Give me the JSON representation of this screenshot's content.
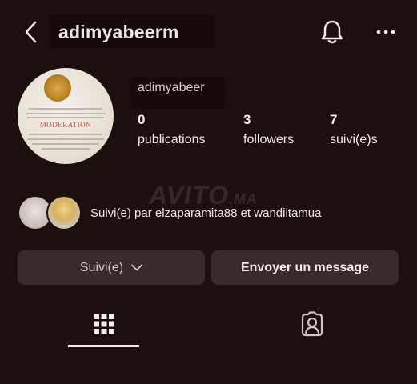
{
  "header": {
    "username": "adimyabeerm",
    "back_icon": "chevron-left-icon",
    "notification_icon": "bell-icon",
    "more_icon": "ellipsis-horizontal-icon"
  },
  "profile": {
    "name": "adimyabeer",
    "avatar_text": "MODERATION",
    "stats": [
      {
        "value": "0",
        "label": "publications"
      },
      {
        "value": "3",
        "label": "followers"
      },
      {
        "value": "7",
        "label": "suivi(e)s"
      }
    ]
  },
  "watermark": {
    "main": "AVITO",
    "suffix": ".MA"
  },
  "mutual": {
    "text": "Suivi(e) par elzaparamita88 et wandiitamua"
  },
  "actions": {
    "following_label": "Suivi(e)",
    "message_label": "Envoyer un message"
  },
  "tabs": [
    {
      "icon": "grid-icon",
      "active": true
    },
    {
      "icon": "tagged-person-icon",
      "active": false
    }
  ],
  "colors": {
    "background": "#1e0f0f",
    "button": "#3a2b2b",
    "text": "#f2ecec"
  }
}
